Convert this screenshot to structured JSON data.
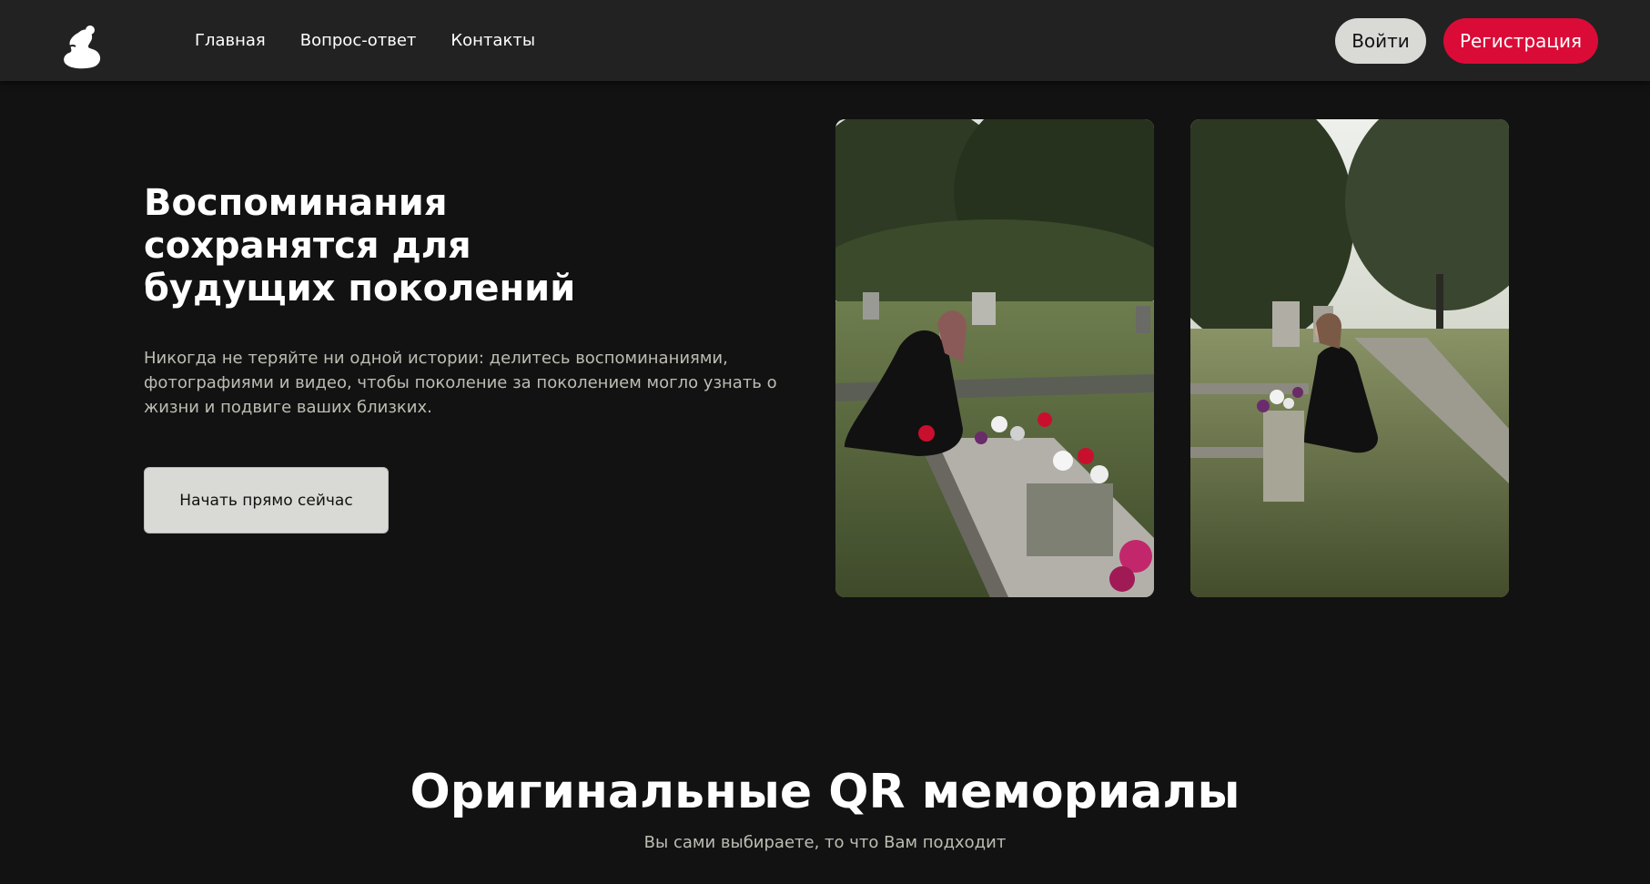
{
  "header": {
    "logo_icon": "silhouette-logo-icon",
    "nav": [
      {
        "label": "Главная"
      },
      {
        "label": "Вопрос-ответ"
      },
      {
        "label": "Контакты"
      }
    ],
    "login_label": "Войти",
    "register_label": "Регистрация"
  },
  "hero": {
    "title": "Воспоминания сохранятся для будущих поколений",
    "text": "Никогда не теряйте ни одной истории: делитесь воспоминаниями, фотографиями и видео, чтобы поколение за поколением могло узнать о жизни и подвиге ваших близких.",
    "cta_label": "Начать прямо сейчас"
  },
  "section": {
    "title": "Оригинальные QR мемориалы",
    "subtitle": "Вы сами выбираете, то что Вам подходит"
  },
  "colors": {
    "background": "#121212",
    "header": "#222222",
    "accent": "#db0b37",
    "button_light": "#d9d9d6",
    "muted_text": "#bdbdb4"
  }
}
